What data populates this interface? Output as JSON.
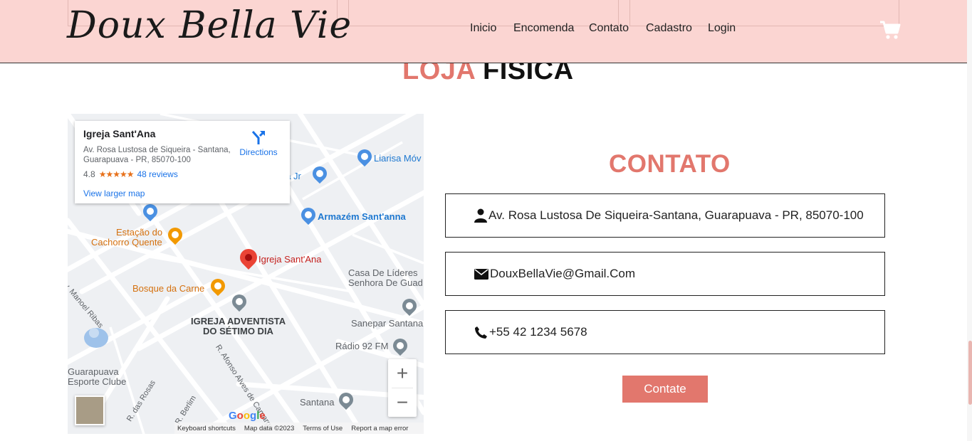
{
  "header": {
    "logo_text": "Doux Bella Vie",
    "nav": [
      "Inicio",
      "Encomenda",
      "Contato",
      "Cadastro",
      "Login"
    ]
  },
  "store_section": {
    "title_part1": "LOJA",
    "title_part2": "FISICA"
  },
  "map": {
    "card": {
      "place_name": "Igreja Sant'Ana",
      "address": "Av. Rosa Lustosa de Siqueira - Santana, Guarapuava - PR, 85070-100",
      "rating": "4.8",
      "stars": "★★★★★",
      "reviews": "48 reviews",
      "larger_map": "View larger map",
      "directions": "Directions"
    },
    "labels": {
      "liarisa": "Liarisa Móv",
      "jr": "ria Jr",
      "armazem": "Armazém Sant'anna",
      "estacao_1": "Estação do",
      "estacao_2": "Cachorro Quente",
      "igreja": "Igreja Sant'Ana",
      "casa_1": "Casa De Líderes",
      "casa_2": "Senhora De Guad",
      "bosque": "Bosque da Carne",
      "adventista_1": "IGREJA ADVENTISTA",
      "adventista_2": "DO SÉTIMO DIA",
      "manoel": "Av. Manoel Ribas",
      "sanepar": "Sanepar Santana",
      "radio": "Rádio 92 FM",
      "afonso": "R. Afonso Alves de Camargo",
      "guarapuava_1": "Guarapuava",
      "guarapuava_2": "Esporte Clube",
      "rosas": "R. das Rosas",
      "berlim": "R. Berlim",
      "santana": "Santana"
    },
    "zoom_in": "+",
    "zoom_out": "−",
    "google": "Google",
    "attribution": [
      "Keyboard shortcuts",
      "Map data ©2023",
      "Terms of Use",
      "Report a map error"
    ]
  },
  "contact": {
    "title": "CONTATO",
    "address": "Av. Rosa Lustosa De Siqueira-Santana, Guarapuava - PR, 85070-100",
    "email": "DouxBellaVie@Gmail.Com",
    "phone": "+55 42 1234 5678",
    "button": "Contate"
  },
  "colors": {
    "header_bg": "#fbd5d2",
    "accent": "#e2776d"
  }
}
